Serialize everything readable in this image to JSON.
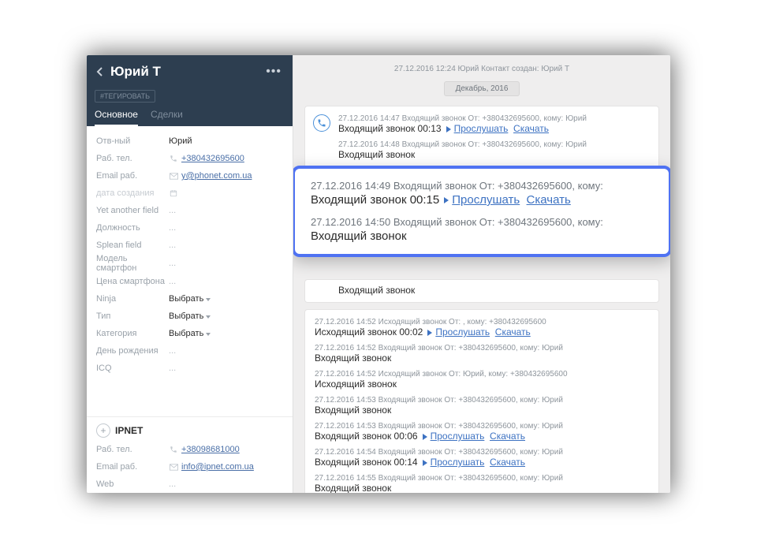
{
  "colors": {
    "accent": "#4f72f2",
    "link": "#3d72c2",
    "headerBg": "#2d3e50"
  },
  "header": {
    "contactName": "Юрий Т",
    "tagButton": "#ТЕГИРОВАТЬ",
    "tabs": {
      "main": "Основное",
      "deals": "Сделки"
    },
    "activeTab": "main"
  },
  "fields": [
    {
      "label": "Отв-ный",
      "value": "Юрий",
      "kind": "text"
    },
    {
      "label": "Раб. тел.",
      "value": "+380432695600",
      "kind": "link",
      "icon": "phone"
    },
    {
      "label": "Email раб.",
      "value": "y@phonet.com.ua",
      "kind": "link",
      "icon": "mail"
    },
    {
      "label": "дата создания",
      "value": "",
      "kind": "faded",
      "icon": "calendar",
      "labelFaded": true
    },
    {
      "label": "Yet another field",
      "value": "...",
      "kind": "dots"
    },
    {
      "label": "Должность",
      "value": "...",
      "kind": "dots"
    },
    {
      "label": "Splean field",
      "value": "...",
      "kind": "dots"
    },
    {
      "label": "Модель смартфон",
      "value": "...",
      "kind": "dots"
    },
    {
      "label": "Цена смартфона",
      "value": "...",
      "kind": "dots"
    },
    {
      "label": "Ninja",
      "value": "Выбрать",
      "kind": "select"
    },
    {
      "label": "Тип",
      "value": "Выбрать",
      "kind": "select"
    },
    {
      "label": "Категория",
      "value": "Выбрать",
      "kind": "select"
    },
    {
      "label": "День рождения",
      "value": "...",
      "kind": "dots"
    },
    {
      "label": "ICQ",
      "value": "...",
      "kind": "dots"
    }
  ],
  "company": {
    "name": "IPNET",
    "fields": [
      {
        "label": "Раб. тел.",
        "value": "+38098681000",
        "kind": "link",
        "icon": "phone"
      },
      {
        "label": "Email раб.",
        "value": "info@ipnet.com.ua",
        "kind": "link",
        "icon": "mail"
      },
      {
        "label": "Web",
        "value": "...",
        "kind": "dots"
      }
    ]
  },
  "timeline": {
    "creationLine": "27.12.2016 12:24 Юрий Контакт создан: Юрий Т",
    "monthBadge": "Декабрь, 2016",
    "card1": [
      {
        "meta": "27.12.2016 14:47 Входящий звонок От: +380432695600, кому: Юрий",
        "main": "Входящий звонок 00:13",
        "listen": "Прослушать",
        "download": "Скачать"
      },
      {
        "meta": "27.12.2016 14:48 Входящий звонок От: +380432695600, кому: Юрий",
        "main": "Входящий звонок"
      }
    ],
    "highlight": [
      {
        "meta": "27.12.2016 14:49 Входящий звонок От: +380432695600, кому:",
        "main": "Входящий звонок 00:15",
        "listen": "Прослушать",
        "download": "Скачать"
      },
      {
        "meta": "27.12.2016 14:50 Входящий звонок От: +380432695600, кому:",
        "main": "Входящий звонок"
      }
    ],
    "underSnippet": {
      "main": "Входящий звонок"
    },
    "card2": [
      {
        "meta": "27.12.2016 14:52 Исходящий звонок От: , кому: +380432695600",
        "main": "Исходящий звонок 00:02",
        "listen": "Прослушать",
        "download": "Скачать"
      },
      {
        "meta": "27.12.2016 14:52 Входящий звонок От: +380432695600, кому: Юрий",
        "main": "Входящий звонок"
      },
      {
        "meta": "27.12.2016 14:52 Исходящий звонок От: Юрий, кому: +380432695600",
        "main": "Исходящий звонок"
      },
      {
        "meta": "27.12.2016 14:53 Входящий звонок От: +380432695600, кому: Юрий",
        "main": "Входящий звонок"
      },
      {
        "meta": "27.12.2016 14:53 Входящий звонок От: +380432695600, кому: Юрий",
        "main": "Входящий звонок 00:06",
        "listen": "Прослушать",
        "download": "Скачать"
      },
      {
        "meta": "27.12.2016 14:54 Входящий звонок От: +380432695600, кому: Юрий",
        "main": "Входящий звонок 00:14",
        "listen": "Прослушать",
        "download": "Скачать"
      },
      {
        "meta": "27.12.2016 14:55 Входящий звонок От: +380432695600, кому: Юрий",
        "main": "Входящий звонок"
      }
    ]
  },
  "labels": {
    "listen": "Прослушать",
    "download": "Скачать"
  }
}
